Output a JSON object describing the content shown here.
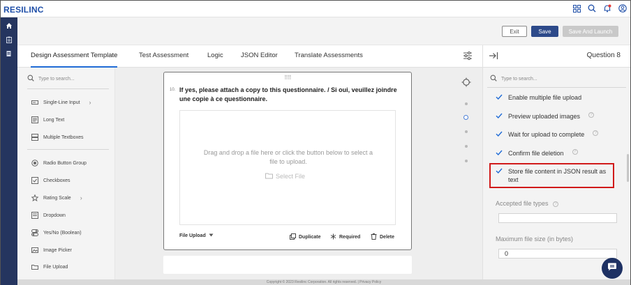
{
  "app": {
    "logo": "RESILINC"
  },
  "header": {
    "icons": [
      "grid-icon",
      "search-icon",
      "bell-icon",
      "user-icon"
    ]
  },
  "actions": {
    "exit": "Exit",
    "save": "Save",
    "save_launch": "Save And Launch"
  },
  "tabs": [
    {
      "label": "Design Assessment Template",
      "active": true
    },
    {
      "label": "Test Assessment"
    },
    {
      "label": "Logic"
    },
    {
      "label": "JSON Editor"
    },
    {
      "label": "Translate Assessments"
    }
  ],
  "toolbox": {
    "search_placeholder": "Type to search...",
    "items": [
      {
        "label": "Single-Line Input",
        "icon": "single-line-icon",
        "submenu": true
      },
      {
        "label": "Long Text",
        "icon": "long-text-icon"
      },
      {
        "label": "Multiple Textboxes",
        "icon": "multi-text-icon"
      },
      {
        "label": "Radio Button Group",
        "icon": "radio-icon"
      },
      {
        "label": "Checkboxes",
        "icon": "checkbox-icon"
      },
      {
        "label": "Rating Scale",
        "icon": "star-icon",
        "submenu": true
      },
      {
        "label": "Dropdown",
        "icon": "dropdown-icon"
      },
      {
        "label": "Yes/No (Boolean)",
        "icon": "toggle-icon"
      },
      {
        "label": "Image Picker",
        "icon": "image-icon"
      },
      {
        "label": "File Upload",
        "icon": "folder-icon"
      }
    ]
  },
  "question": {
    "number": "10.",
    "title": "If yes, please attach a copy to this questionnaire. / Si oui, veuillez joindre une copie à ce questionnaire.",
    "drop_text": "Drag and drop a file here or click the button below to select a file to upload.",
    "select_file": "Select File",
    "type": "File Upload",
    "duplicate": "Duplicate",
    "required": "Required",
    "delete": "Delete"
  },
  "properties": {
    "title": "Question 8",
    "search_placeholder": "Type to search...",
    "checks": [
      {
        "label": "Enable multiple file upload",
        "checked": true,
        "help": false
      },
      {
        "label": "Preview uploaded images",
        "checked": true,
        "help": true
      },
      {
        "label": "Wait for upload to complete",
        "checked": true,
        "help": true
      },
      {
        "label": "Confirm file deletion",
        "checked": true,
        "help": true
      },
      {
        "label": "Store file content in JSON result as text",
        "checked": true,
        "help": false,
        "highlighted": true
      }
    ],
    "accepted_label": "Accepted file types",
    "accepted_value": "",
    "max_size_label": "Maximum file size (in bytes)",
    "max_size_value": "0"
  },
  "footer": {
    "text": "Copyright © 2023 Resilinc Corporation. All rights reserved. | Privacy Policy"
  },
  "colors": {
    "nav": "#25355f",
    "primary": "#2d4a8a",
    "highlight": "#d11a1a",
    "check": "#1f6bd6"
  }
}
